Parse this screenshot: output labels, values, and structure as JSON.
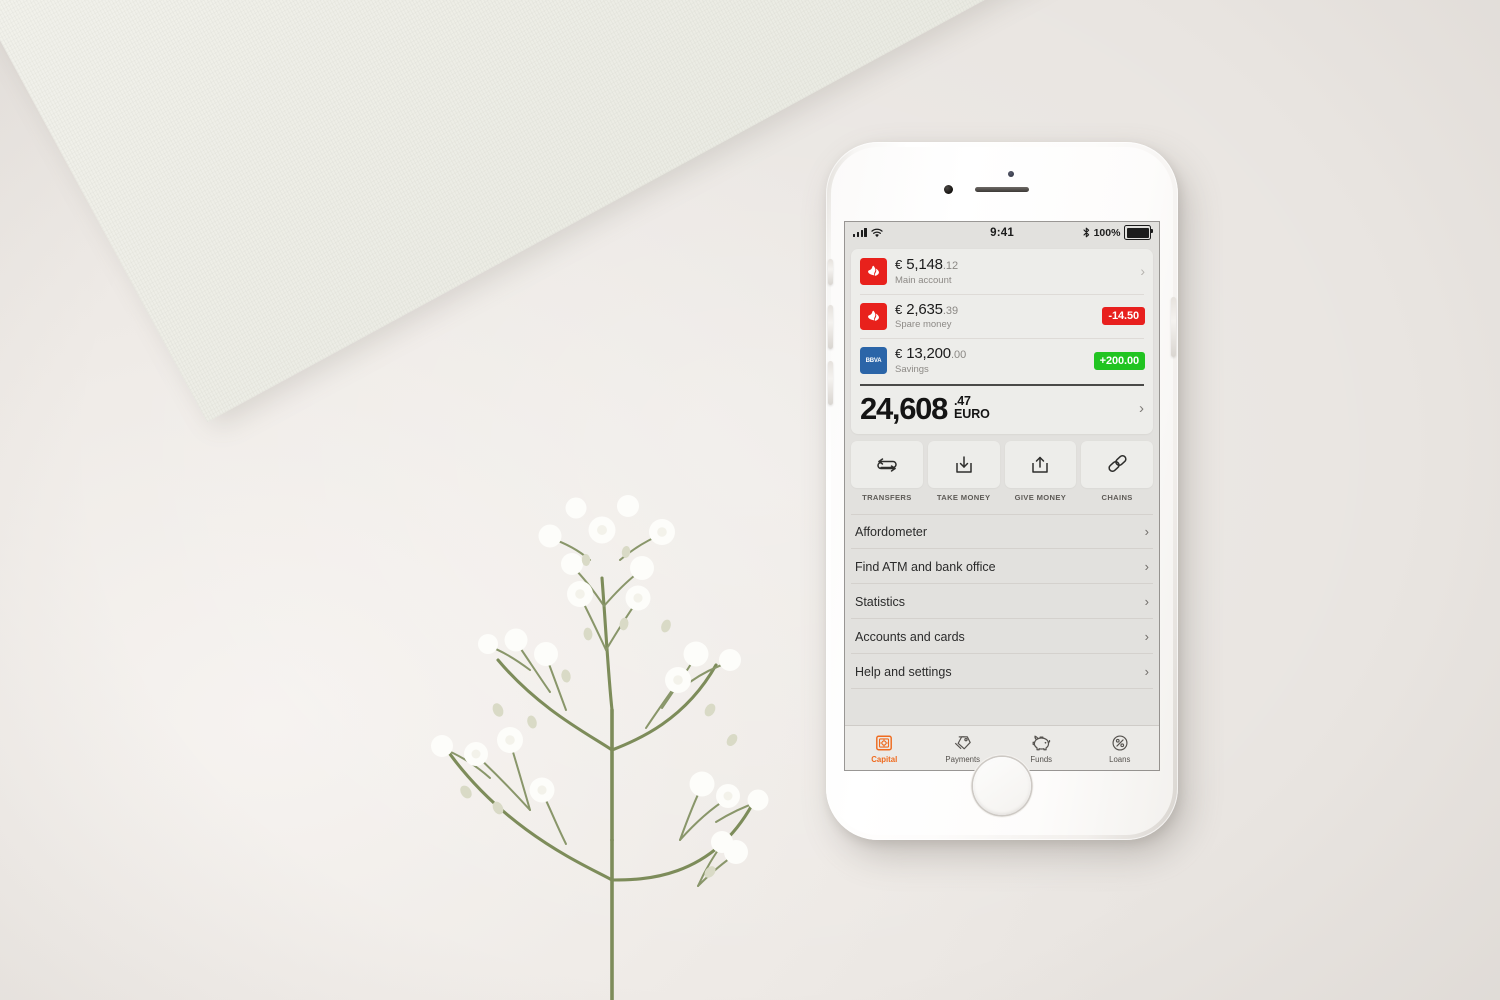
{
  "scene": {
    "description": "flat-lay photo: white smartphone on off-white surface with paper sheet and gypsophila sprig",
    "background_color": "#f2efeb",
    "paper_color": "#eeeee7"
  },
  "phone": {
    "body_color": "#ffffff",
    "screen_background": "#e2e1de"
  },
  "status_bar": {
    "signal_icon": "signal-bars-icon",
    "wifi_icon": "wifi-icon",
    "time": "9:41",
    "bluetooth_icon": "bluetooth-icon",
    "battery_percent": "100%",
    "battery_icon": "battery-full-icon"
  },
  "accounts": {
    "rows": [
      {
        "bank": "Santander",
        "logo": "santander-flame-icon",
        "logo_color": "#e8211c",
        "currency": "€",
        "whole": "5,148",
        "cents": ".12",
        "name": "Main account",
        "badge": "",
        "badge_type": "none",
        "chevron": "›"
      },
      {
        "bank": "Santander",
        "logo": "santander-flame-icon",
        "logo_color": "#e8211c",
        "currency": "€",
        "whole": "2,635",
        "cents": ".39",
        "name": "Spare money",
        "badge": "-14.50",
        "badge_type": "negative",
        "chevron": ""
      },
      {
        "bank": "BBVA",
        "logo": "bbva-logo",
        "logo_text": "BBVA",
        "logo_color": "#2b65a8",
        "currency": "€",
        "whole": "13,200",
        "cents": ".00",
        "name": "Savings",
        "badge": "+200.00",
        "badge_type": "positive",
        "chevron": ""
      }
    ],
    "badge_colors": {
      "negative": "#e8201e",
      "positive": "#21c421"
    }
  },
  "total": {
    "amount": "24,608",
    "cents": ".47",
    "currency_label": "EURO",
    "chevron": "›"
  },
  "actions": [
    {
      "label": "TRANSFERS",
      "icon": "transfer-arrows-icon"
    },
    {
      "label": "TAKE MONEY",
      "icon": "download-tray-icon"
    },
    {
      "label": "GIVE MONEY",
      "icon": "upload-tray-icon"
    },
    {
      "label": "CHAINS",
      "icon": "chain-link-icon"
    }
  ],
  "menu": [
    {
      "label": "Affordometer",
      "chevron": "›"
    },
    {
      "label": "Find ATM and bank office",
      "chevron": "›"
    },
    {
      "label": "Statistics",
      "chevron": "›"
    },
    {
      "label": "Accounts and cards",
      "chevron": "›"
    },
    {
      "label": "Help and settings",
      "chevron": "›"
    }
  ],
  "tabs": [
    {
      "label": "Capital",
      "icon": "safe-vault-icon",
      "active": true,
      "color": "#ef6b1f"
    },
    {
      "label": "Payments",
      "icon": "price-tags-icon",
      "active": false
    },
    {
      "label": "Funds",
      "icon": "piggy-bank-icon",
      "active": false
    },
    {
      "label": "Loans",
      "icon": "percent-circle-icon",
      "active": false
    }
  ]
}
